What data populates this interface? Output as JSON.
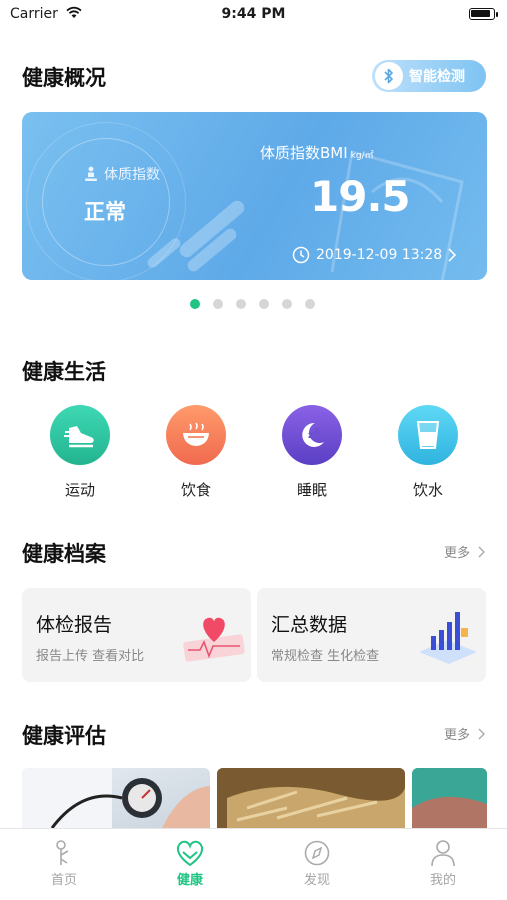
{
  "status_bar": {
    "carrier": "Carrier",
    "time": "9:44 PM"
  },
  "overview": {
    "title": "健康概况",
    "smart_detect_label": "智能检测",
    "bmi_card": {
      "index_label": "体质指数",
      "status": "正常",
      "bmi_label": "体质指数BMI",
      "bmi_unit": "kg/㎡",
      "bmi_value": "19.5",
      "timestamp": "2019-12-09 13:28"
    },
    "carousel": {
      "total": 6,
      "active_index": 0
    }
  },
  "life": {
    "title": "健康生活",
    "items": [
      {
        "label": "运动",
        "icon": "running-shoe-icon",
        "color": "#2fc4a3"
      },
      {
        "label": "饮食",
        "icon": "bowl-icon",
        "color": "#f77d5c"
      },
      {
        "label": "睡眠",
        "icon": "moon-zz-icon",
        "color": "#6c4fd0"
      },
      {
        "label": "饮水",
        "icon": "water-glass-icon",
        "color": "#3fc5e8"
      }
    ]
  },
  "archive": {
    "title": "健康档案",
    "more_label": "更多",
    "cards": [
      {
        "title": "体检报告",
        "subtitle": "报告上传  查看对比",
        "icon": "heart-report-icon"
      },
      {
        "title": "汇总数据",
        "subtitle": "常规检查  生化检查",
        "icon": "bar-chart-icon"
      }
    ]
  },
  "assessment": {
    "title": "健康评估",
    "more_label": "更多"
  },
  "tabbar": {
    "active_index": 1,
    "tabs": [
      {
        "label": "首页",
        "icon": "home-icon"
      },
      {
        "label": "健康",
        "icon": "heart-icon"
      },
      {
        "label": "发现",
        "icon": "compass-icon"
      },
      {
        "label": "我的",
        "icon": "person-icon"
      }
    ]
  },
  "colors": {
    "accent": "#20c483",
    "card_blue": "#5ea9e8",
    "muted": "#888888"
  }
}
